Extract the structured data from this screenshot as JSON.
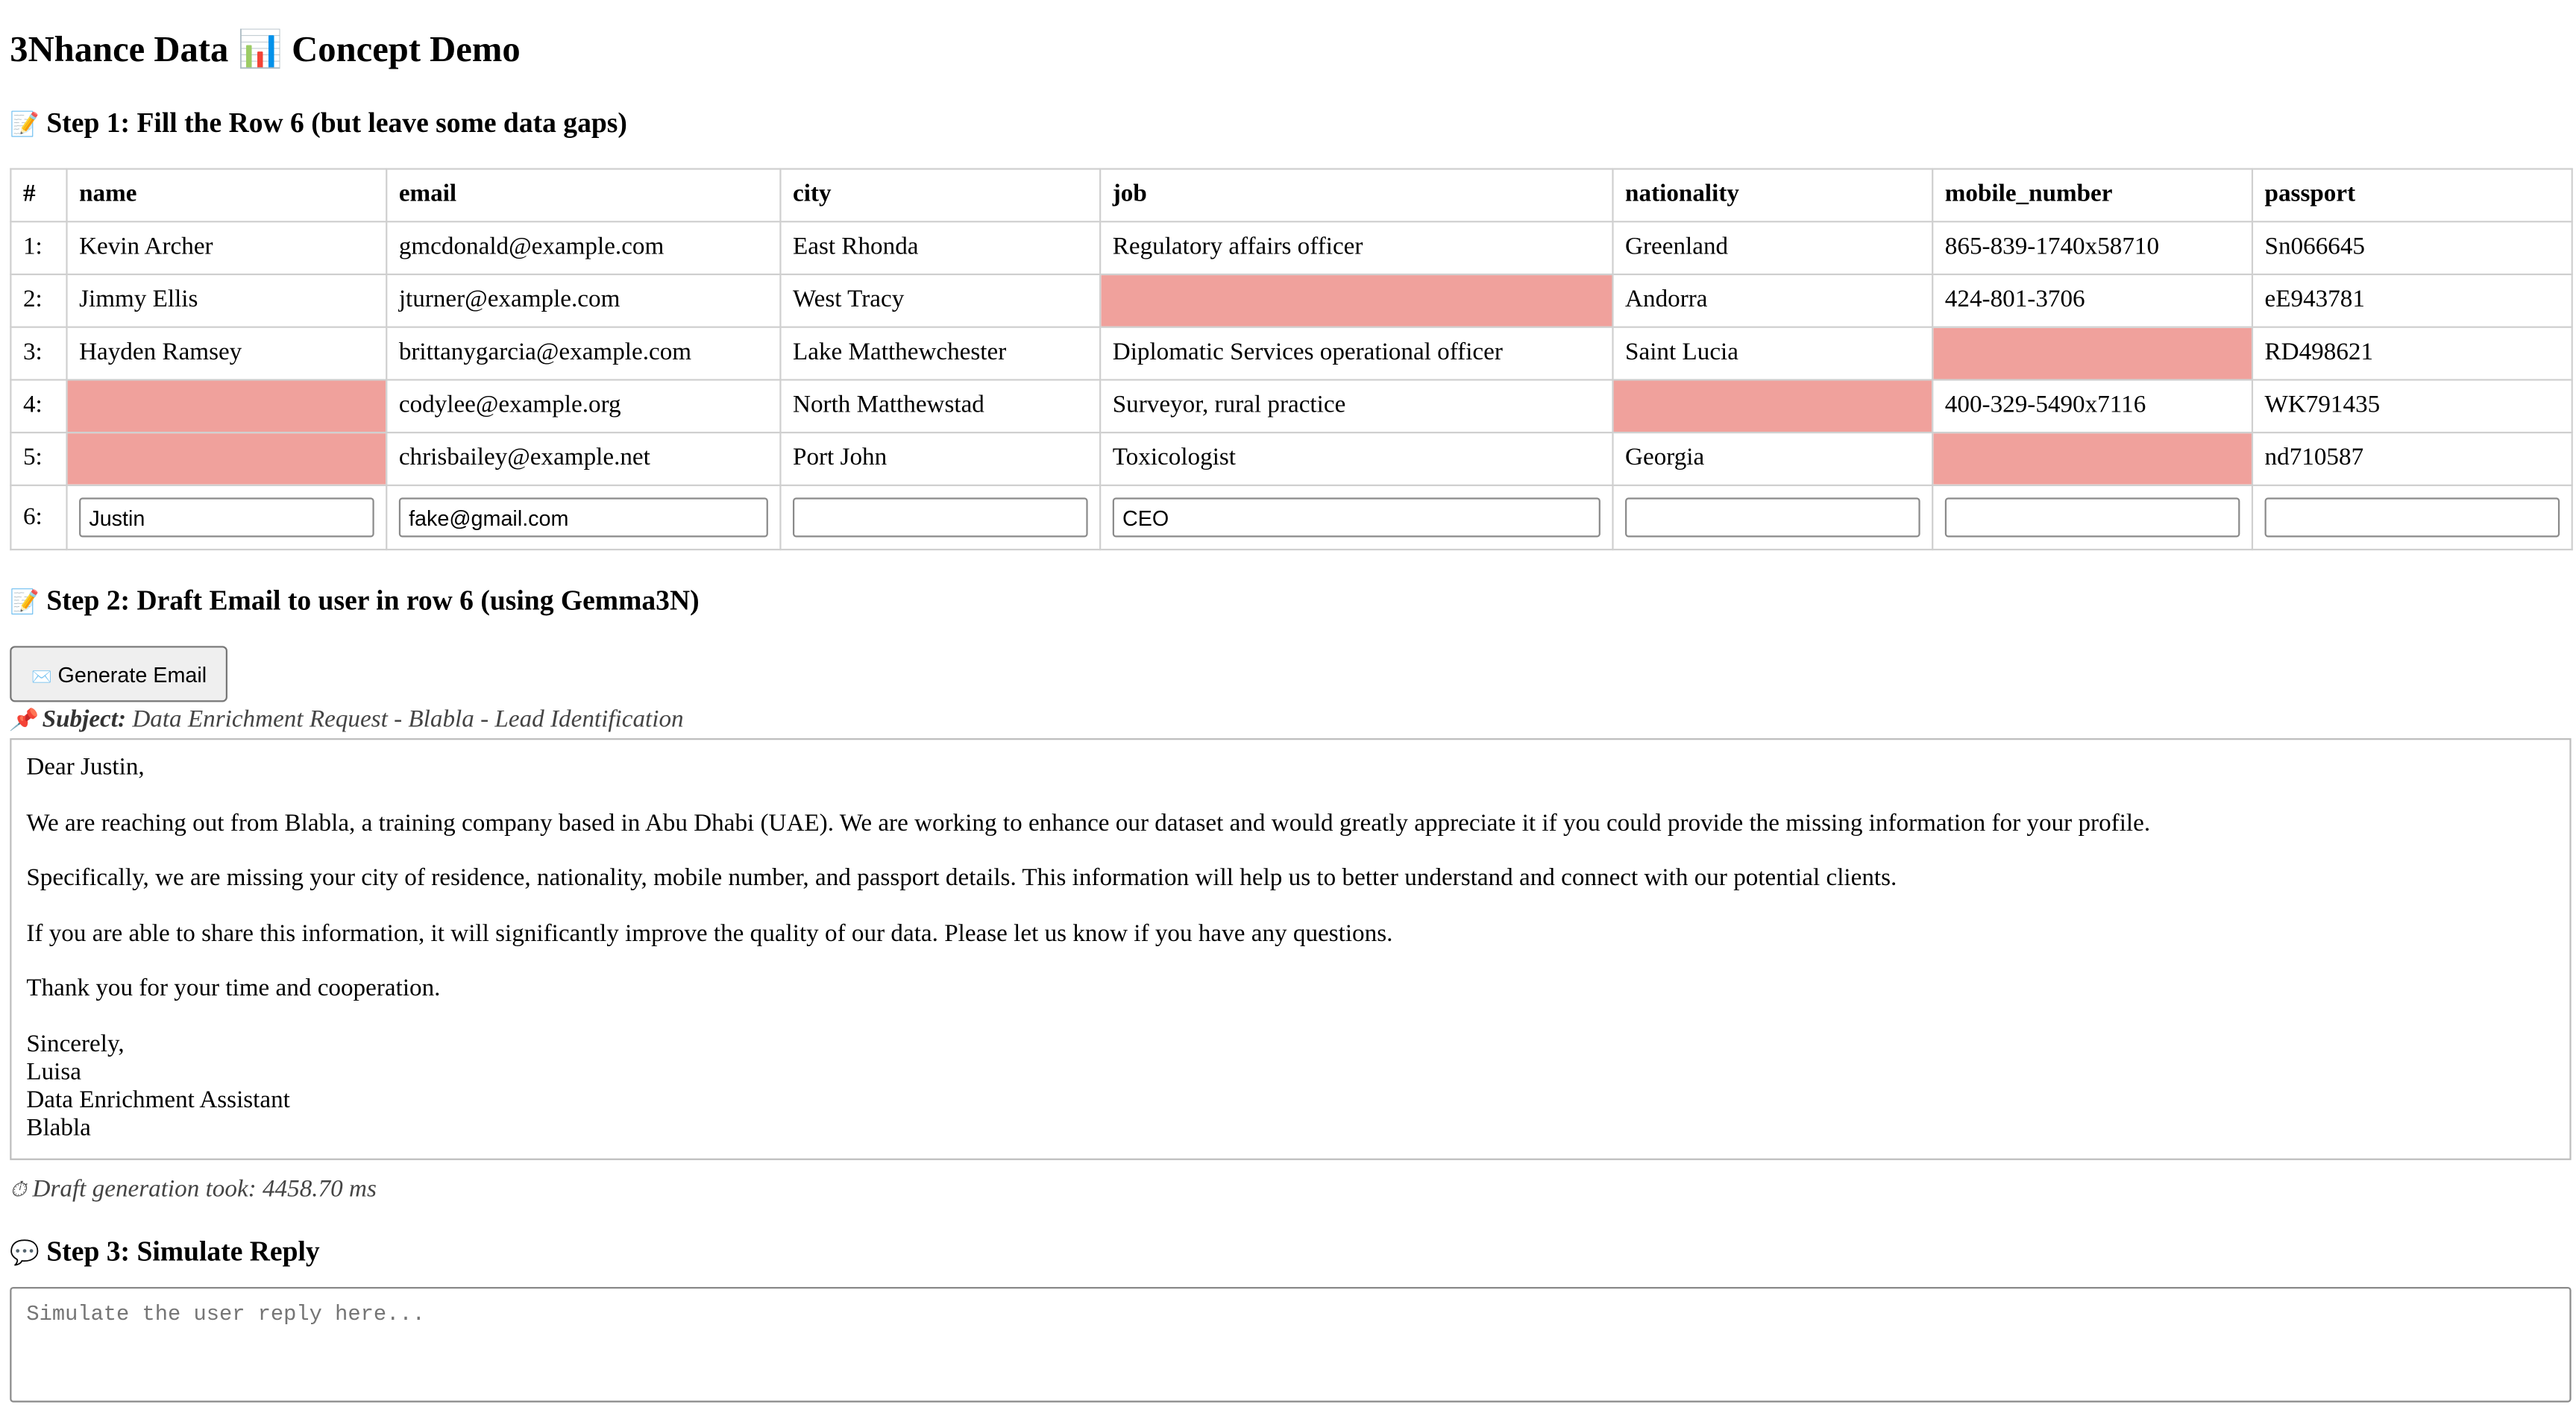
{
  "page": {
    "title": "3Nhance Data 📊 Concept Demo",
    "step1_icon": "📝",
    "step1_title": "Step 1: Fill the Row 6 (but leave some data gaps)",
    "step2_icon": "📝",
    "step2_title": "Step 2: Draft Email to user in row 6 (using Gemma3N)",
    "step3_icon": "💬",
    "step3_title": "Step 3: Simulate Reply"
  },
  "table": {
    "headers": [
      "#",
      "name",
      "email",
      "city",
      "job",
      "nationality",
      "mobile_number",
      "passport"
    ],
    "rows": [
      {
        "num": "1:",
        "cells": [
          "Kevin Archer",
          "gmcdonald@example.com",
          "East Rhonda",
          "Regulatory affairs officer",
          "Greenland",
          "865-839-1740x58710",
          "Sn066645"
        ]
      },
      {
        "num": "2:",
        "cells": [
          "Jimmy Ellis",
          "jturner@example.com",
          "West Tracy",
          "",
          "Andorra",
          "424-801-3706",
          "eE943781"
        ]
      },
      {
        "num": "3:",
        "cells": [
          "Hayden Ramsey",
          "brittanygarcia@example.com",
          "Lake Matthewchester",
          "Diplomatic Services operational officer",
          "Saint Lucia",
          "",
          "RD498621"
        ]
      },
      {
        "num": "4:",
        "cells": [
          "",
          "codylee@example.org",
          "North Matthewstad",
          "Surveyor, rural practice",
          "",
          "400-329-5490x7116",
          "WK791435"
        ]
      },
      {
        "num": "5:",
        "cells": [
          "",
          "chrisbailey@example.net",
          "Port John",
          "Toxicologist",
          "Georgia",
          "",
          "nd710587"
        ]
      }
    ],
    "input_row": {
      "num": "6:",
      "values": [
        "Justin",
        "fake@gmail.com",
        "",
        "CEO",
        "",
        "",
        ""
      ]
    }
  },
  "generate": {
    "icon": "✉️",
    "label": "Generate Email"
  },
  "subject": {
    "icon": "📌",
    "label": "Subject:",
    "text": "Data Enrichment Request - Blabla - Lead Identification"
  },
  "email": {
    "greeting": "Dear Justin,",
    "p1": "We are reaching out from Blabla, a training company based in Abu Dhabi (UAE). We are working to enhance our dataset and would greatly appreciate it if you could provide the missing information for your profile.",
    "p2": "Specifically, we are missing your city of residence, nationality, mobile number, and passport details. This information will help us to better understand and connect with our potential clients.",
    "p3": "If you are able to share this information, it will significantly improve the quality of our data. Please let us know if you have any questions.",
    "p4": "Thank you for your time and cooperation.",
    "sign_lines": [
      "Sincerely,",
      "Luisa",
      "Data Enrichment Assistant",
      "Blabla"
    ]
  },
  "timing": {
    "icon": "⏱",
    "text": "Draft generation took: 4458.70 ms"
  },
  "reply": {
    "placeholder": "Simulate the user reply here..."
  },
  "colors": {
    "missing_cell": "#f0a19c"
  }
}
